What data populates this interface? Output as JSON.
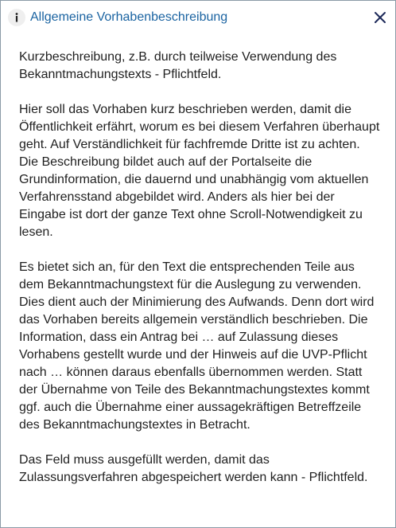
{
  "dialog": {
    "title": "Allgemeine Vorhabenbeschreibung",
    "info_icon": "info-icon",
    "close_icon": "close-icon",
    "accent_color": "#1a63a1",
    "paragraphs": [
      "Kurzbeschreibung, z.B. durch teilweise Verwendung des Bekanntmachungstexts - Pflichtfeld.",
      "Hier soll das Vorhaben kurz beschrieben werden, damit die Öffentlichkeit erfährt, worum es bei diesem Verfahren überhaupt geht. Auf Verständlichkeit für fachfremde Dritte ist zu achten. Die Beschreibung bildet auch auf der Portalseite die Grundinformation, die dauernd und unabhängig vom aktuellen Verfahrensstand abgebildet wird. Anders als hier bei der Eingabe ist dort der ganze Text ohne Scroll-Notwendigkeit zu lesen.",
      "Es bietet sich an, für den Text die entsprechenden Teile aus dem Bekanntmachungstext für die Auslegung zu verwenden. Dies dient auch der Minimierung des Aufwands. Denn dort wird das Vorhaben bereits allgemein verständlich beschrieben. Die Information, dass ein Antrag bei … auf Zulassung dieses Vorhabens gestellt wurde und der Hinweis auf die UVP-Pflicht nach … können daraus ebenfalls übernommen werden. Statt der Übernahme von Teile des Bekanntmachungstextes kommt ggf. auch die Übernahme einer aussagekräftigen Betreffzeile des Bekanntmachungstextes in Betracht.",
      "Das Feld muss ausgefüllt werden, damit das Zulassungsverfahren abgespeichert werden kann - Pflichtfeld."
    ]
  }
}
